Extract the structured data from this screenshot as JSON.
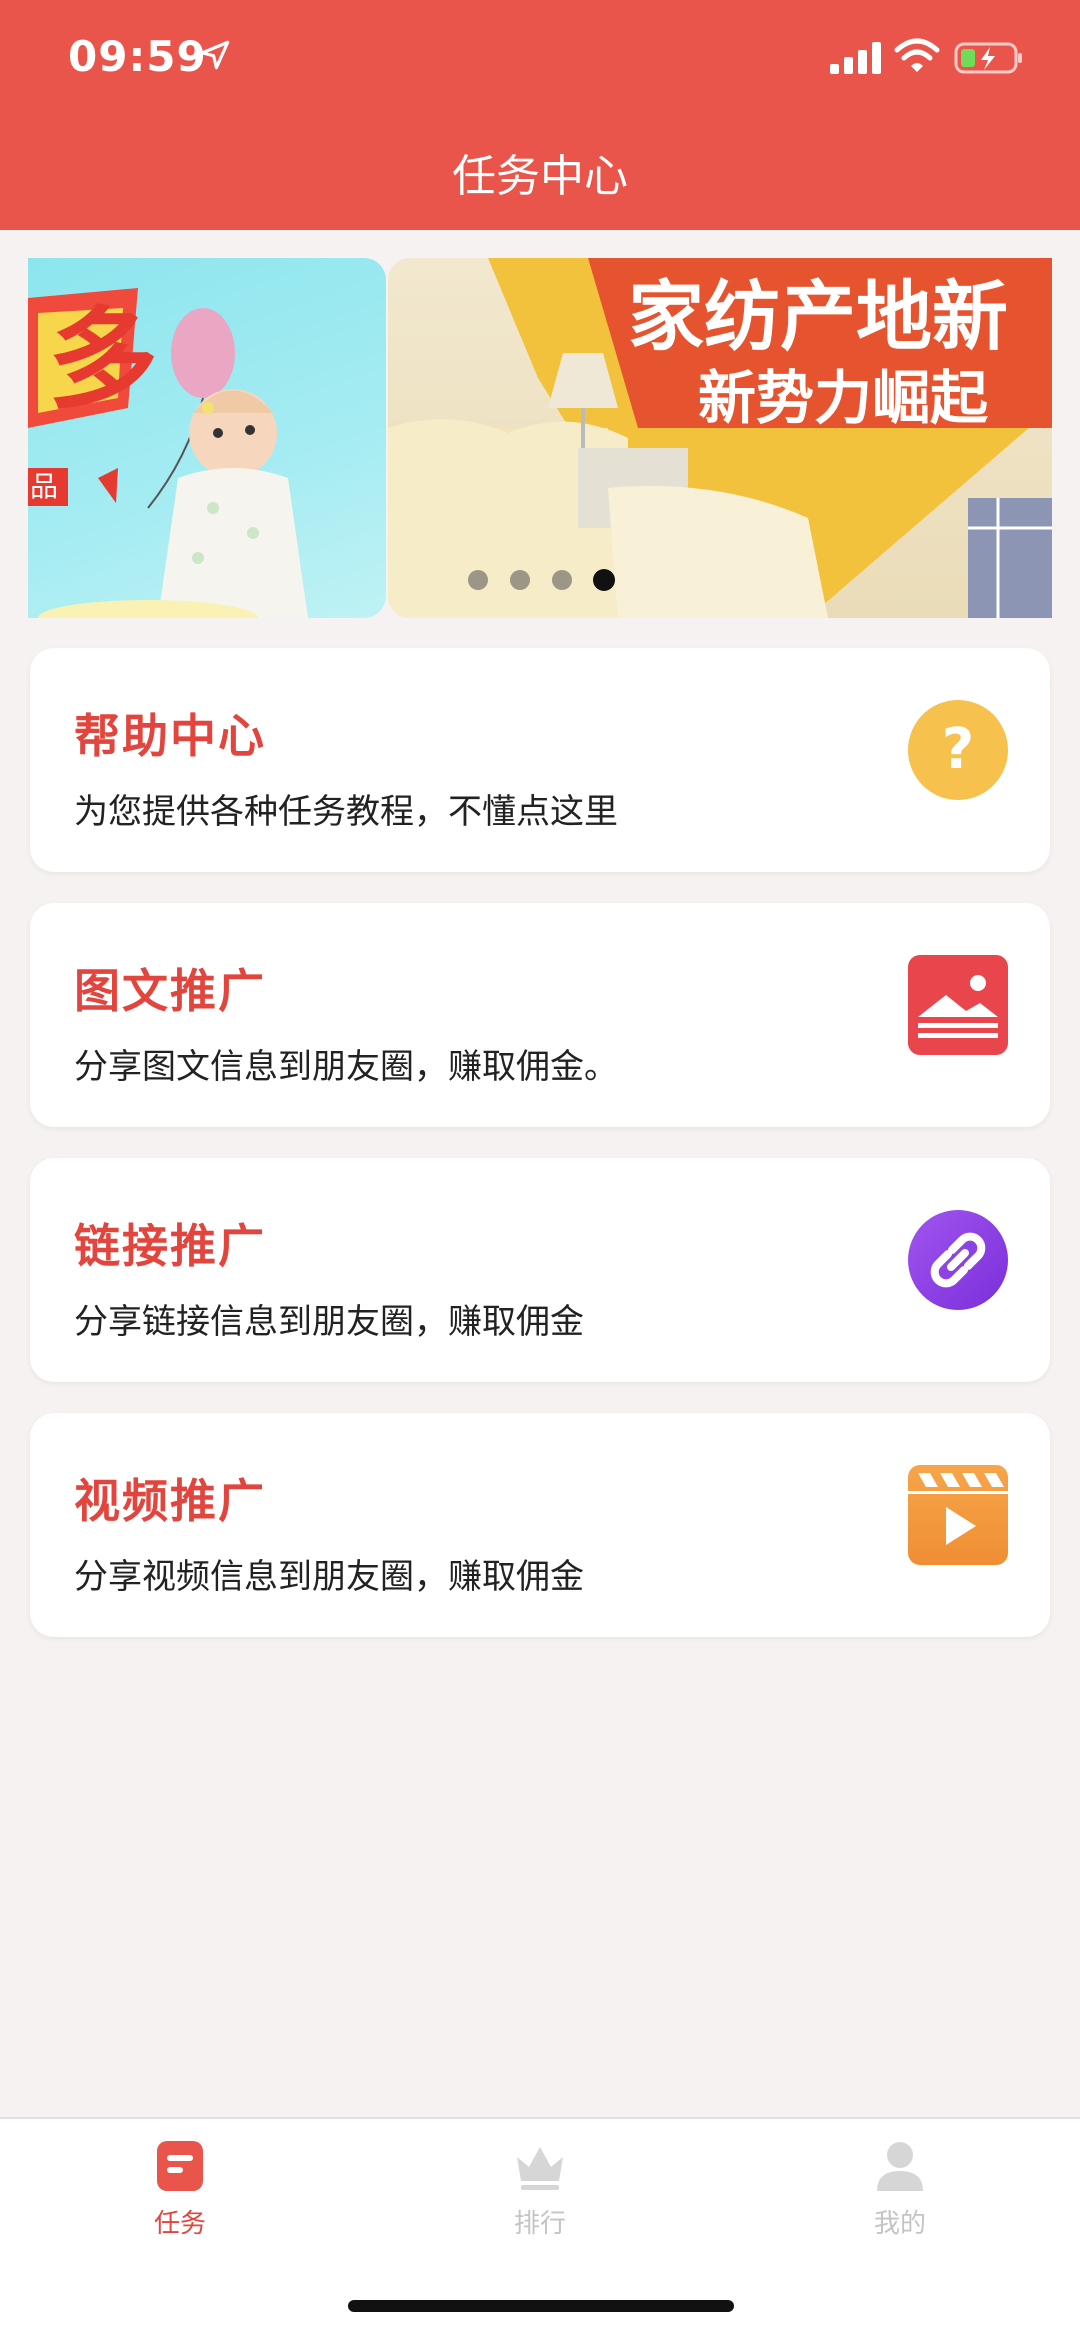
{
  "status": {
    "time": "09:59"
  },
  "header": {
    "title": "任务中心"
  },
  "banner": {
    "slides": [
      {
        "text_main": "",
        "text_sub": "品"
      },
      {
        "text_main": "家纺产地新",
        "text_sub": "新势力崛起"
      }
    ],
    "dot_count": 4,
    "active_dot": 4
  },
  "cards": [
    {
      "title": "帮助中心",
      "desc": "为您提供各种任务教程，不懂点这里",
      "icon": "help-icon",
      "icon_color": "#f6c14d"
    },
    {
      "title": "图文推广",
      "desc": "分享图文信息到朋友圈，赚取佣金。",
      "icon": "image-icon",
      "icon_color": "#e8464c"
    },
    {
      "title": "链接推广",
      "desc": "分享链接信息到朋友圈，赚取佣金",
      "icon": "link-icon",
      "icon_color": "#8e3ee6"
    },
    {
      "title": "视频推广",
      "desc": "分享视频信息到朋友圈，赚取佣金",
      "icon": "video-icon",
      "icon_color": "#f49a3c"
    }
  ],
  "tabbar": {
    "items": [
      {
        "label": "任务",
        "icon": "task-icon",
        "active": true
      },
      {
        "label": "排行",
        "icon": "crown-icon",
        "active": false
      },
      {
        "label": "我的",
        "icon": "user-icon",
        "active": false
      }
    ]
  },
  "colors": {
    "header": "#ea554b",
    "accent": "#e2453d",
    "background": "#f6f2f1"
  }
}
